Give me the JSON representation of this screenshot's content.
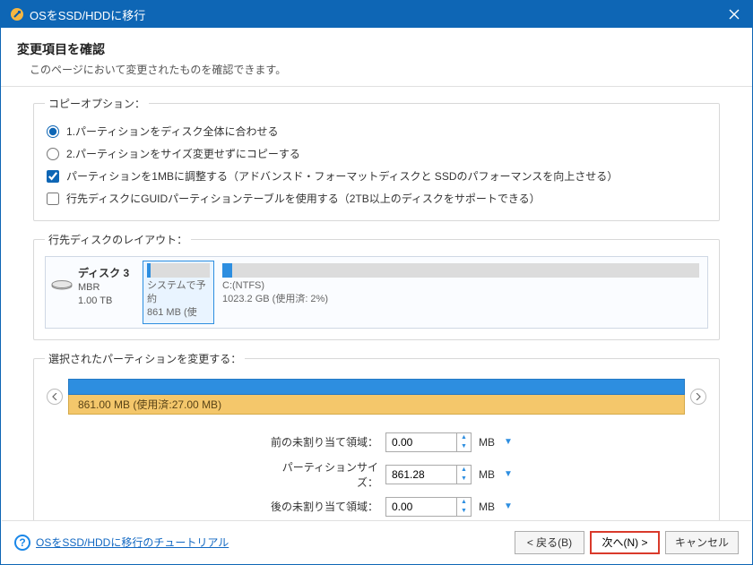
{
  "window": {
    "title": "OSをSSD/HDDに移行"
  },
  "header": {
    "title": "変更項目を確認",
    "subtitle": "このページにおいて変更されたものを確認できます。"
  },
  "copy_options": {
    "legend": "コピーオプション：",
    "radio1": "1.パーティションをディスク全体に合わせる",
    "radio2": "2.パーティションをサイズ変更せずにコピーする",
    "check1": "パーティションを1MBに調整する（アドバンスド・フォーマットディスクと SSDのパフォーマンスを向上させる）",
    "check2": "行先ディスクにGUIDパーティションテーブルを使用する（2TB以上のディスクをサポートできる）",
    "radio_selected": "1",
    "check1_checked": true,
    "check2_checked": false
  },
  "disk_layout": {
    "legend": "行先ディスクのレイアウト：",
    "disk": {
      "name": "ディスク 3",
      "type": "MBR",
      "size": "1.00 TB"
    },
    "partitions": [
      {
        "label": "システムで予約",
        "size": "861 MB (使",
        "used_pct": "5%"
      },
      {
        "label": "C:(NTFS)",
        "size": "1023.2 GB (使用済: 2%)",
        "used_pct": "2%"
      }
    ]
  },
  "selected_partition": {
    "legend": "選択されたパーティションを変更する：",
    "info": "861.00 MB (使用済:27.00 MB)"
  },
  "size_form": {
    "before_label": "前の未割り当て領域：",
    "before_value": "0.00",
    "size_label": "パーティションサイズ：",
    "size_value": "861.28",
    "after_label": "後の未割り当て領域：",
    "after_value": "0.00",
    "unit": "MB"
  },
  "footer": {
    "tutorial": "OSをSSD/HDDに移行のチュートリアル",
    "back": "< 戻る(B)",
    "next": "次へ(N) >",
    "cancel": "キャンセル"
  }
}
